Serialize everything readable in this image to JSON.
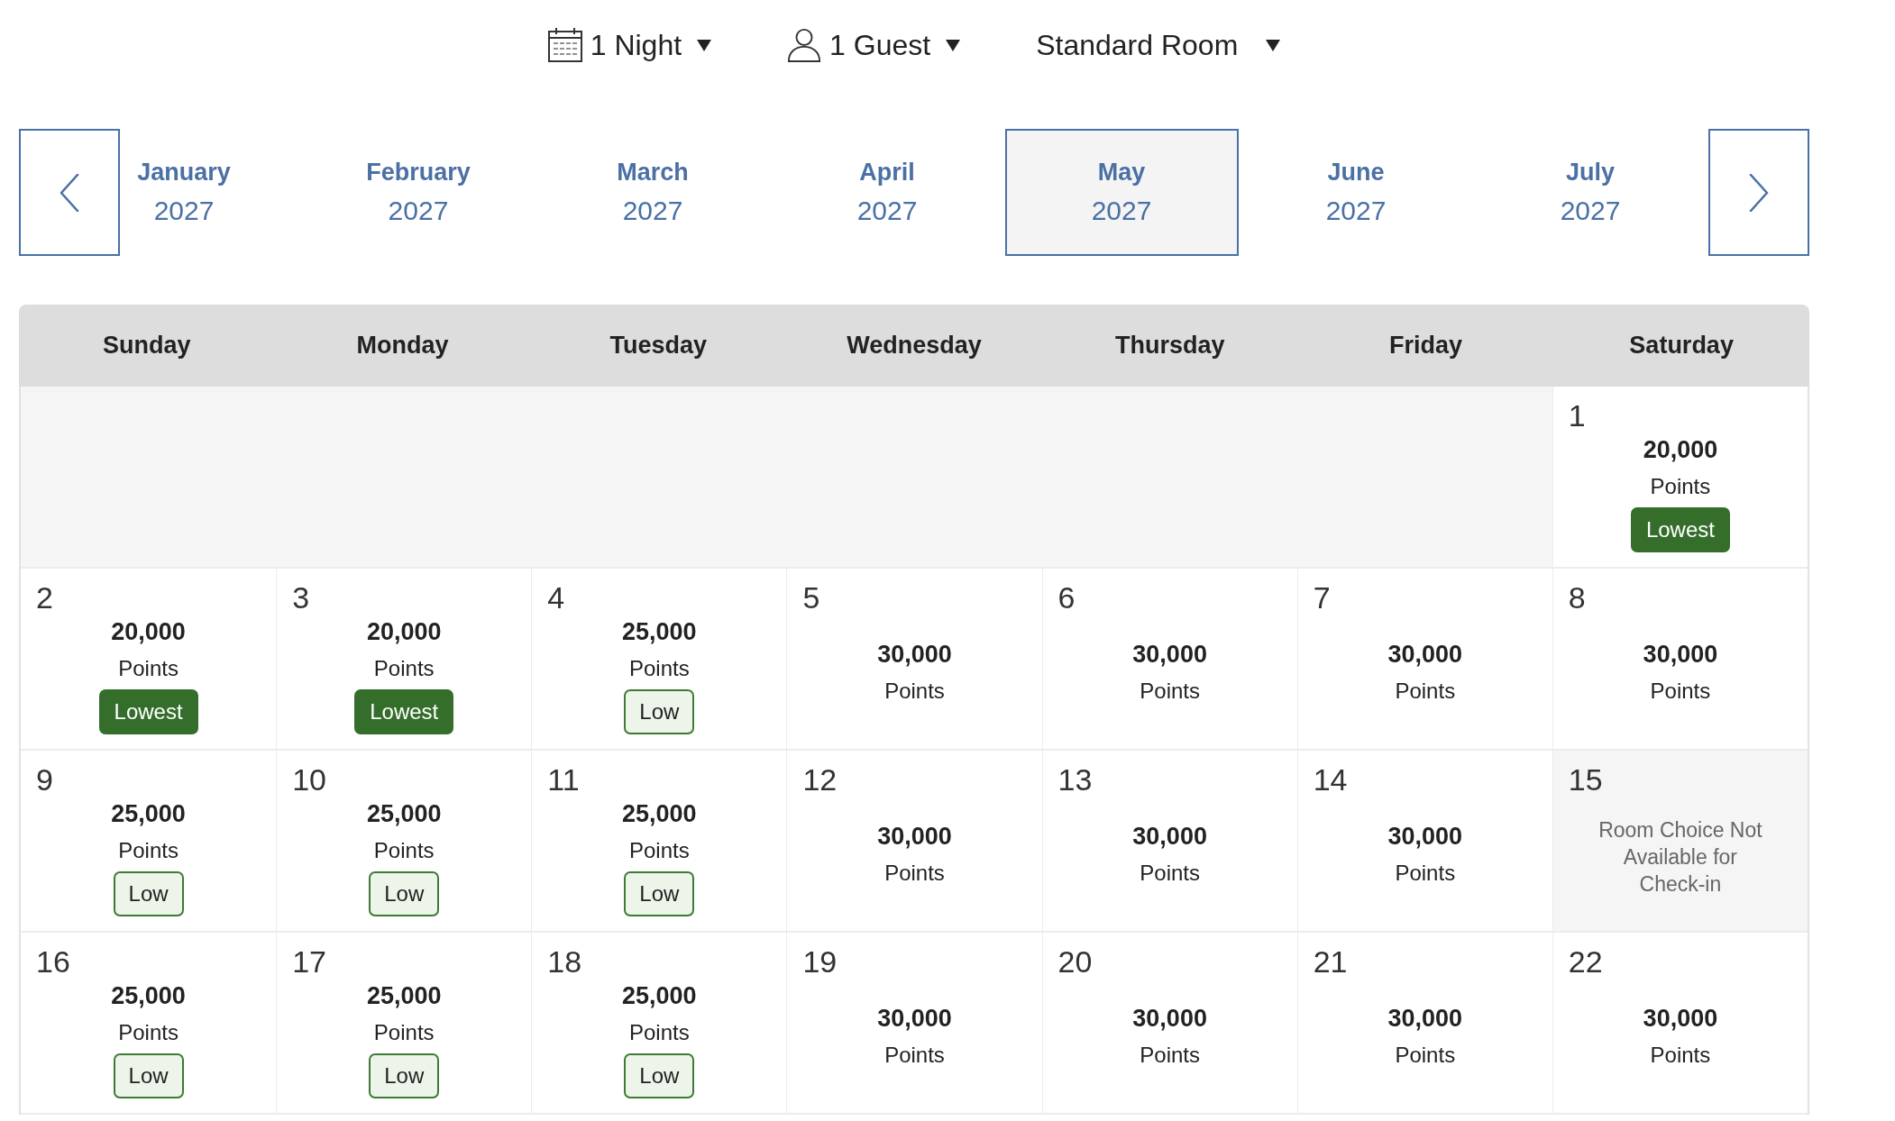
{
  "filters": [
    {
      "kind": "nights",
      "label": "1 Night"
    },
    {
      "kind": "guests",
      "label": "1 Guest"
    },
    {
      "kind": "room",
      "label": "Standard Room"
    }
  ],
  "month_nav": {
    "months": [
      {
        "month": "January",
        "year": "2027",
        "selected": false
      },
      {
        "month": "February",
        "year": "2027",
        "selected": false
      },
      {
        "month": "March",
        "year": "2027",
        "selected": false
      },
      {
        "month": "April",
        "year": "2027",
        "selected": false
      },
      {
        "month": "May",
        "year": "2027",
        "selected": true
      },
      {
        "month": "June",
        "year": "2027",
        "selected": false
      },
      {
        "month": "July",
        "year": "2027",
        "selected": false
      }
    ]
  },
  "calendar": {
    "weekdays": [
      "Sunday",
      "Monday",
      "Tuesday",
      "Wednesday",
      "Thursday",
      "Friday",
      "Saturday"
    ],
    "weeks": [
      {
        "days": [
          {
            "kind": "blank"
          },
          {
            "kind": "blank"
          },
          {
            "kind": "blank"
          },
          {
            "kind": "blank"
          },
          {
            "kind": "blank"
          },
          {
            "kind": "blank"
          },
          {
            "kind": "priced",
            "day": "1",
            "points": "20,000",
            "unit": "Points",
            "tag": {
              "kind": "lowest",
              "label": "Lowest"
            }
          }
        ]
      },
      {
        "days": [
          {
            "kind": "priced",
            "day": "2",
            "points": "20,000",
            "unit": "Points",
            "tag": {
              "kind": "lowest",
              "label": "Lowest"
            }
          },
          {
            "kind": "priced",
            "day": "3",
            "points": "20,000",
            "unit": "Points",
            "tag": {
              "kind": "lowest",
              "label": "Lowest"
            }
          },
          {
            "kind": "priced",
            "day": "4",
            "points": "25,000",
            "unit": "Points",
            "tag": {
              "kind": "low",
              "label": "Low"
            }
          },
          {
            "kind": "priced",
            "day": "5",
            "points": "30,000",
            "unit": "Points"
          },
          {
            "kind": "priced",
            "day": "6",
            "points": "30,000",
            "unit": "Points"
          },
          {
            "kind": "priced",
            "day": "7",
            "points": "30,000",
            "unit": "Points"
          },
          {
            "kind": "priced",
            "day": "8",
            "points": "30,000",
            "unit": "Points"
          }
        ]
      },
      {
        "days": [
          {
            "kind": "priced",
            "day": "9",
            "points": "25,000",
            "unit": "Points",
            "tag": {
              "kind": "low",
              "label": "Low"
            }
          },
          {
            "kind": "priced",
            "day": "10",
            "points": "25,000",
            "unit": "Points",
            "tag": {
              "kind": "low",
              "label": "Low"
            }
          },
          {
            "kind": "priced",
            "day": "11",
            "points": "25,000",
            "unit": "Points",
            "tag": {
              "kind": "low",
              "label": "Low"
            }
          },
          {
            "kind": "priced",
            "day": "12",
            "points": "30,000",
            "unit": "Points"
          },
          {
            "kind": "priced",
            "day": "13",
            "points": "30,000",
            "unit": "Points"
          },
          {
            "kind": "priced",
            "day": "14",
            "points": "30,000",
            "unit": "Points"
          },
          {
            "kind": "unavailable",
            "day": "15",
            "note": "Room Choice Not Available for Check-in"
          }
        ]
      },
      {
        "days": [
          {
            "kind": "priced",
            "day": "16",
            "points": "25,000",
            "unit": "Points",
            "tag": {
              "kind": "low",
              "label": "Low"
            }
          },
          {
            "kind": "priced",
            "day": "17",
            "points": "25,000",
            "unit": "Points",
            "tag": {
              "kind": "low",
              "label": "Low"
            }
          },
          {
            "kind": "priced",
            "day": "18",
            "points": "25,000",
            "unit": "Points",
            "tag": {
              "kind": "low",
              "label": "Low"
            }
          },
          {
            "kind": "priced",
            "day": "19",
            "points": "30,000",
            "unit": "Points"
          },
          {
            "kind": "priced",
            "day": "20",
            "points": "30,000",
            "unit": "Points"
          },
          {
            "kind": "priced",
            "day": "21",
            "points": "30,000",
            "unit": "Points"
          },
          {
            "kind": "priced",
            "day": "22",
            "points": "30,000",
            "unit": "Points"
          }
        ]
      }
    ]
  }
}
